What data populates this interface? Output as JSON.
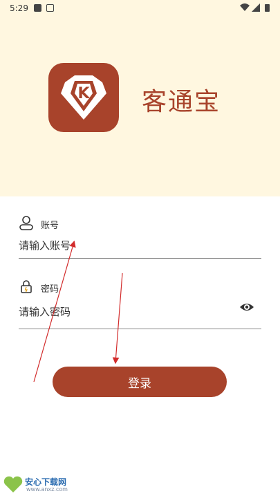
{
  "status_bar": {
    "time": "5:29"
  },
  "app": {
    "name": "客通宝",
    "logo_letter": "K"
  },
  "account": {
    "label": "账号",
    "placeholder": "请输入账号",
    "value": ""
  },
  "password": {
    "label": "密码",
    "placeholder": "请输入密码",
    "value": ""
  },
  "login": {
    "label": "登录"
  },
  "watermark": {
    "title": "安心下载网",
    "url": "www.anxz.com"
  },
  "colors": {
    "brand": "#A8432B",
    "header_bg": "#FFF7E0",
    "annotation": "#D22B2B"
  }
}
